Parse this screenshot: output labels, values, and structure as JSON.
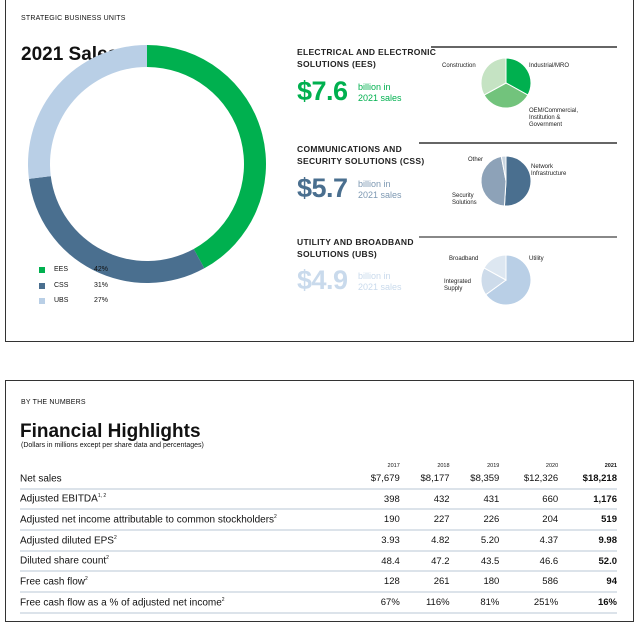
{
  "top": {
    "section_label": "STRATEGIC BUSINESS UNITS",
    "title": "2021 Sales",
    "legend": [
      {
        "label": "EES",
        "pct": "42%",
        "color": "#00b04f"
      },
      {
        "label": "CSS",
        "pct": "31%",
        "color": "#4a6f8f"
      },
      {
        "label": "UBS",
        "pct": "27%",
        "color": "#b9cfe6"
      }
    ],
    "segments": [
      {
        "title1": "ELECTRICAL AND ELECTRONIC",
        "title2": "SOLUTIONS (EES)",
        "amount": "$7.6",
        "unit1": "billion in",
        "unit2": "2021 sales",
        "color": "#00b04f",
        "labels": [
          "Construction",
          "Industrial/MRO",
          "OEM/Commercial,",
          "Institution &",
          "Government"
        ]
      },
      {
        "title1": "COMMUNICATIONS AND",
        "title2": "SECURITY SOLUTIONS (CSS)",
        "amount": "$5.7",
        "unit1": "billion in",
        "unit2": "2021 sales",
        "color": "#4a6f8f",
        "labels": [
          "Other",
          "Network",
          "Infrastructure",
          "Security",
          "Solutions"
        ]
      },
      {
        "title1": "UTILITY AND BROADBAND",
        "title2": "SOLUTIONS (UBS)",
        "amount": "$4.9",
        "unit1": "billion in",
        "unit2": "2021 sales",
        "color": "#c9daec",
        "labels": [
          "Broadband",
          "Utility",
          "Integrated",
          "Supply"
        ]
      }
    ]
  },
  "chart_data": [
    {
      "type": "pie",
      "title": "2021 Sales",
      "donut": true,
      "categories": [
        "EES",
        "CSS",
        "UBS"
      ],
      "values": [
        42,
        31,
        27
      ],
      "colors": [
        "#00b04f",
        "#4a6f8f",
        "#b9cfe6"
      ]
    },
    {
      "type": "pie",
      "title": "EES",
      "categories": [
        "Industrial/MRO",
        "OEM/Commercial, Institution & Government",
        "Construction"
      ],
      "values": [
        33,
        34,
        33
      ],
      "colors": [
        "#00b04f",
        "#72c37c",
        "#c5e3c3"
      ]
    },
    {
      "type": "pie",
      "title": "CSS",
      "categories": [
        "Network Infrastructure",
        "Security Solutions",
        "Other"
      ],
      "values": [
        51,
        46,
        3
      ],
      "colors": [
        "#4a6f8f",
        "#8da2b8",
        "#c9d5e0"
      ]
    },
    {
      "type": "pie",
      "title": "UBS",
      "categories": [
        "Utility",
        "Integrated Supply",
        "Broadband"
      ],
      "values": [
        65,
        18,
        17
      ],
      "colors": [
        "#b9cfe6",
        "#cddbea",
        "#dde7f1"
      ]
    }
  ],
  "bottom": {
    "section_label": "BY THE NUMBERS",
    "title": "Financial Highlights",
    "subtitle": "(Dollars in millions except per share data and percentages)",
    "years": [
      "2017",
      "2018",
      "2019",
      "2020",
      "2021"
    ],
    "rows": [
      {
        "label": "Net sales",
        "sup": "",
        "values": [
          "$7,679",
          "$8,177",
          "$8,359",
          "$12,326",
          "$18,218"
        ]
      },
      {
        "label": "Adjusted EBITDA",
        "sup": "1, 2",
        "values": [
          "398",
          "432",
          "431",
          "660",
          "1,176"
        ]
      },
      {
        "label": "Adjusted net income attributable to common stockholders",
        "sup": "2",
        "values": [
          "190",
          "227",
          "226",
          "204",
          "519"
        ]
      },
      {
        "label": "Adjusted diluted EPS",
        "sup": "2",
        "values": [
          "3.93",
          "4.82",
          "5.20",
          "4.37",
          "9.98"
        ]
      },
      {
        "label": "Diluted share count",
        "sup": "2",
        "values": [
          "48.4",
          "47.2",
          "43.5",
          "46.6",
          "52.0"
        ]
      },
      {
        "label": "Free cash flow",
        "sup": "2",
        "values": [
          "128",
          "261",
          "180",
          "586",
          "94"
        ]
      },
      {
        "label": "Free cash flow as a % of adjusted net income",
        "sup": "2",
        "values": [
          "67%",
          "116%",
          "81%",
          "251%",
          "16%"
        ]
      }
    ]
  }
}
